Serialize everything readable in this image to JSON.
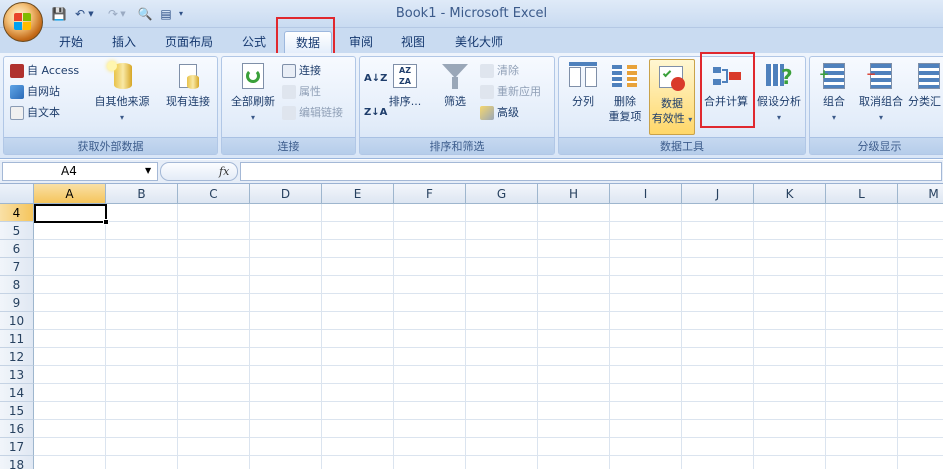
{
  "window": {
    "title": "Book1 - Microsoft Excel"
  },
  "tabs": [
    {
      "label": "开始"
    },
    {
      "label": "插入"
    },
    {
      "label": "页面布局"
    },
    {
      "label": "公式"
    },
    {
      "label": "数据"
    },
    {
      "label": "审阅"
    },
    {
      "label": "视图"
    },
    {
      "label": "美化大师"
    }
  ],
  "ribbon": {
    "get_external": {
      "label": "获取外部数据",
      "access": "自 Access",
      "web": "自网站",
      "text": "自文本",
      "other_sources": "自其他来源",
      "existing": "现有连接"
    },
    "connections": {
      "label": "连接",
      "refresh_all": "全部刷新",
      "connections": "连接",
      "properties": "属性",
      "edit_links": "编辑链接"
    },
    "sort_filter": {
      "label": "排序和筛选",
      "sort": "排序...",
      "filter": "筛选",
      "clear": "清除",
      "reapply": "重新应用",
      "advanced": "高级"
    },
    "data_tools": {
      "label": "数据工具",
      "text_to_columns": "分列",
      "remove_dup_1": "删除",
      "remove_dup_2": "重复项",
      "validation_1": "数据",
      "validation_2": "有效性",
      "consolidate": "合并计算",
      "what_if": "假设分析"
    },
    "outline": {
      "label": "分级显示",
      "group": "组合",
      "ungroup": "取消组合",
      "subtotal": "分类汇"
    }
  },
  "formula_bar": {
    "name_box": "A4",
    "fx": "fx"
  },
  "grid": {
    "columns": [
      "A",
      "B",
      "C",
      "D",
      "E",
      "F",
      "G",
      "H",
      "I",
      "J",
      "K",
      "L",
      "M"
    ],
    "rows": [
      "4",
      "5",
      "6",
      "7",
      "8",
      "9",
      "10",
      "11",
      "12",
      "13",
      "14",
      "15",
      "16",
      "17",
      "18"
    ],
    "selected_cell": "A4"
  },
  "colors": {
    "highlight": "#e0282e",
    "ribbon_bg": "#dbe7f7",
    "header_selected": "#f5c55c"
  }
}
